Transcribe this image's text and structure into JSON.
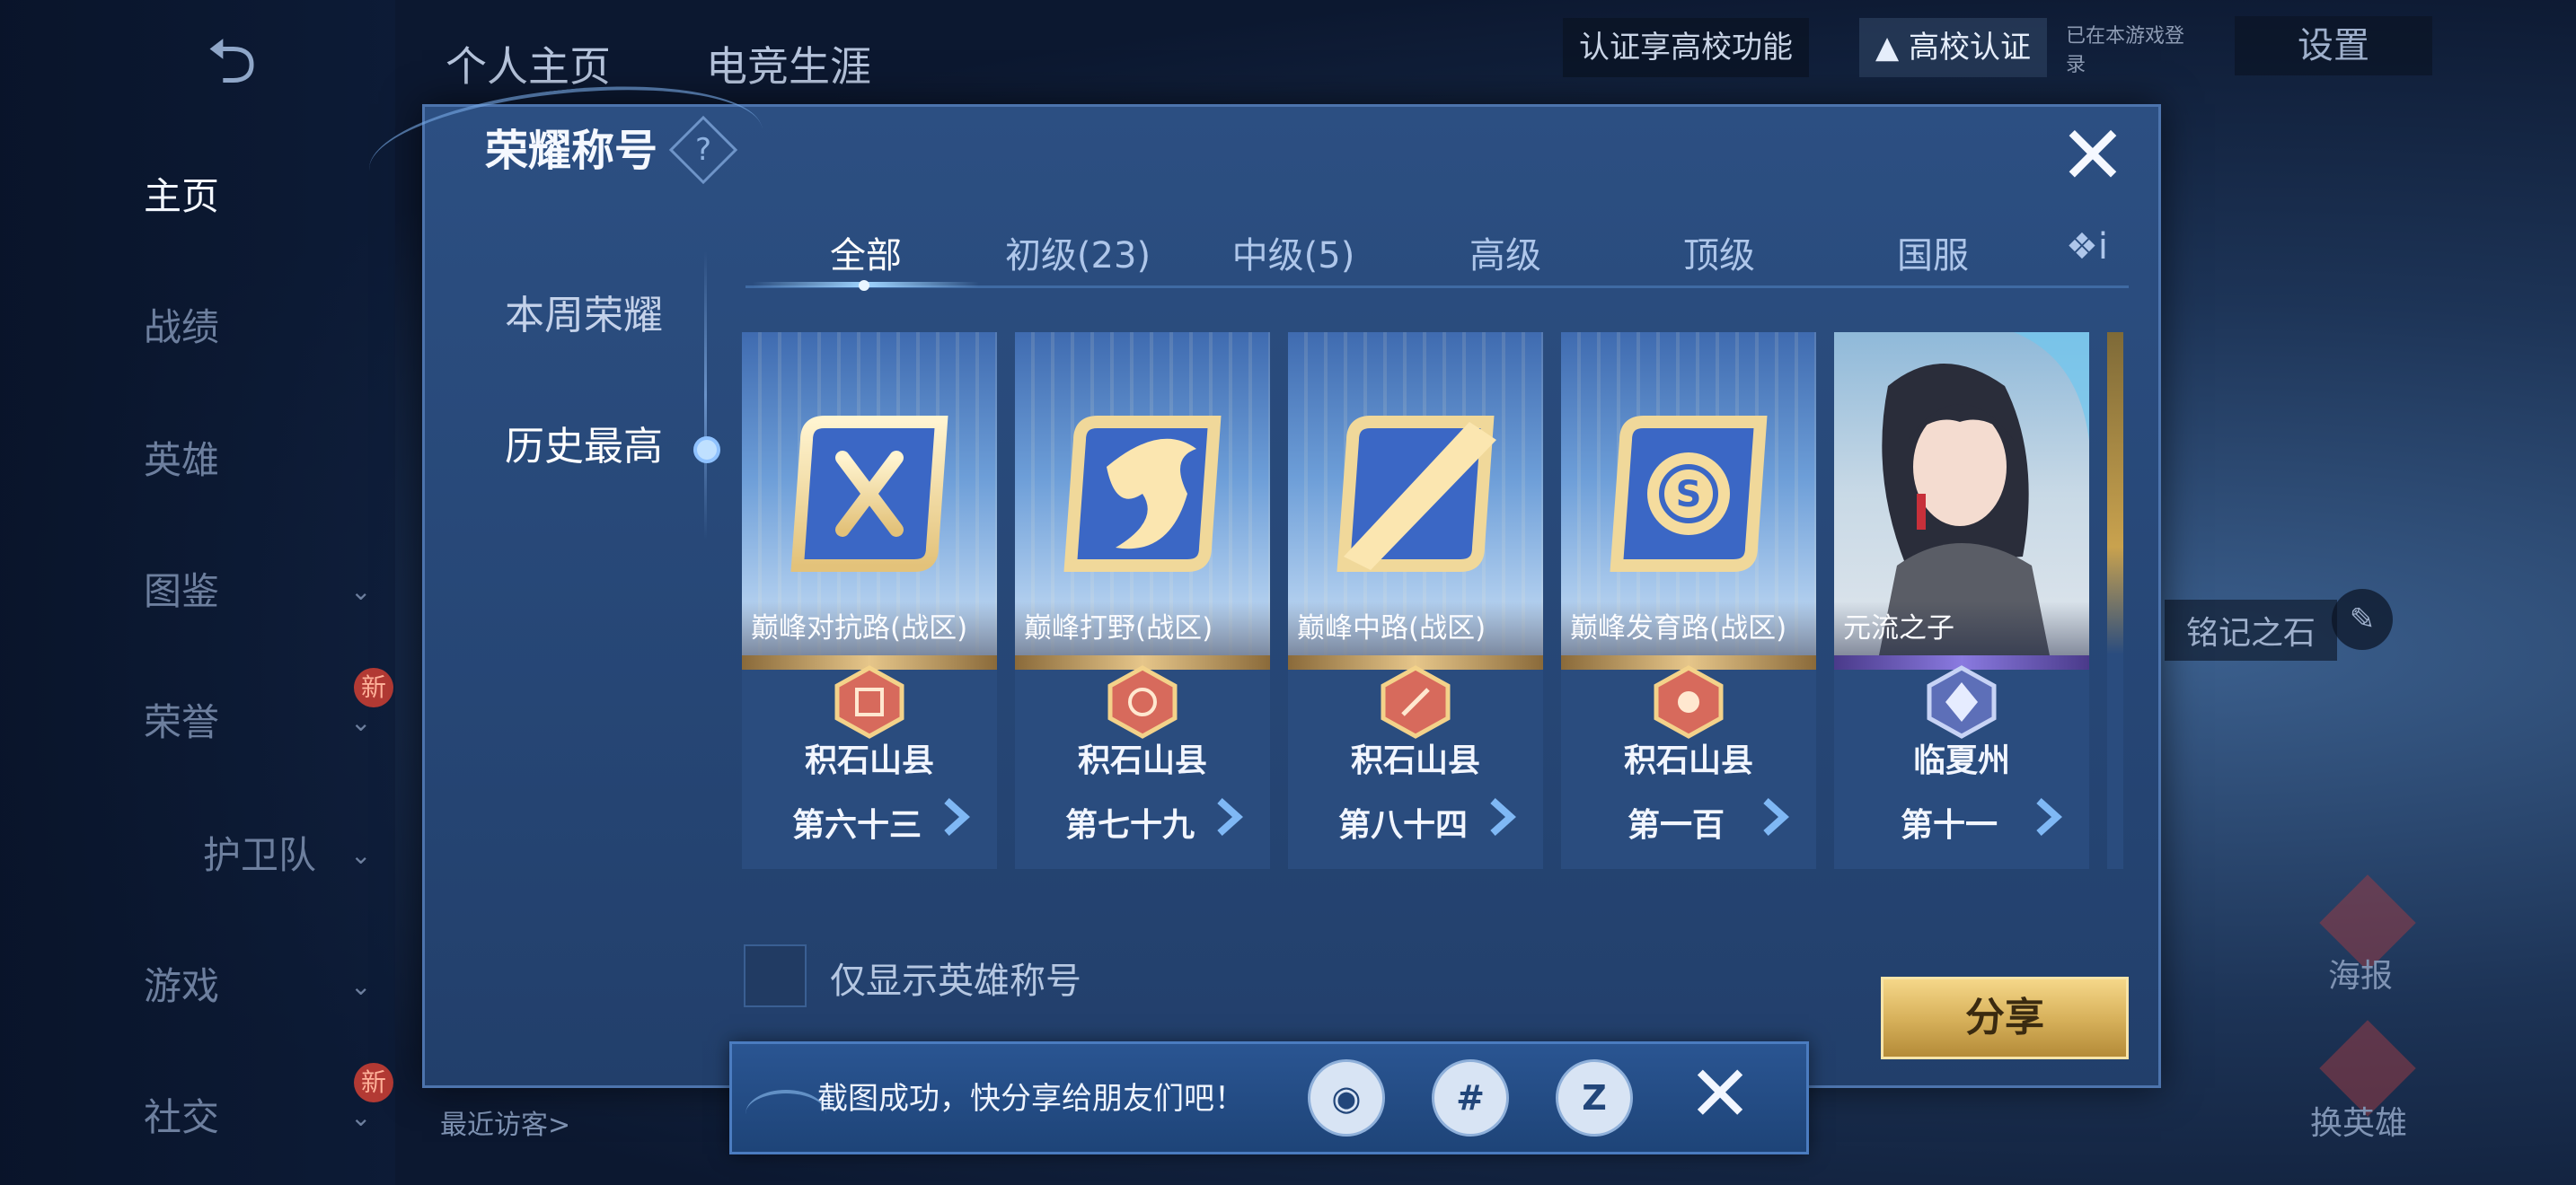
{
  "nav": {
    "back_icon": "back-arrow-icon",
    "items": [
      {
        "label": "主页",
        "active": true,
        "chevron": false,
        "badge": ""
      },
      {
        "label": "战绩",
        "active": false,
        "chevron": false,
        "badge": ""
      },
      {
        "label": "英雄",
        "active": false,
        "chevron": false,
        "badge": ""
      },
      {
        "label": "图鉴",
        "active": false,
        "chevron": true,
        "badge": ""
      },
      {
        "label": "荣誉",
        "active": false,
        "chevron": true,
        "badge": "新"
      },
      {
        "label": "护卫队",
        "active": false,
        "chevron": true,
        "badge": ""
      },
      {
        "label": "游戏",
        "active": false,
        "chevron": true,
        "badge": ""
      },
      {
        "label": "社交",
        "active": false,
        "chevron": true,
        "badge": "新"
      }
    ],
    "recent_visitors": "最近访客>"
  },
  "top": {
    "tabs": [
      "个人主页",
      "电竞生涯"
    ],
    "cert_prompt": "认证享高校功能",
    "cert_button": "高校认证",
    "online_status": "已在本游戏登录",
    "settings": "设置"
  },
  "background": {
    "inscription": "铭记之石",
    "poster": "海报",
    "change_hero": "换英雄"
  },
  "modal": {
    "title": "荣耀称号",
    "side_tabs": [
      {
        "label": "本周荣耀",
        "active": false
      },
      {
        "label": "历史最高",
        "active": true
      }
    ],
    "category_tabs": [
      {
        "label": "全部",
        "active": true
      },
      {
        "label": "初级(23)",
        "active": false
      },
      {
        "label": "中级(5)",
        "active": false
      },
      {
        "label": "高级",
        "active": false
      },
      {
        "label": "顶级",
        "active": false
      },
      {
        "label": "国服",
        "active": false
      },
      {
        "label": "❖i",
        "active": false
      }
    ],
    "cards": [
      {
        "name": "巅峰对抗路(战区)",
        "region": "积石山县",
        "rank": "第六十三",
        "emblem": "sword-emblem-icon"
      },
      {
        "name": "巅峰打野(战区)",
        "region": "积石山县",
        "rank": "第七十九",
        "emblem": "dragon-emblem-icon"
      },
      {
        "name": "巅峰中路(战区)",
        "region": "积石山县",
        "rank": "第八十四",
        "emblem": "slash-emblem-icon"
      },
      {
        "name": "巅峰发育路(战区)",
        "region": "积石山县",
        "rank": "第一百",
        "emblem": "coin-emblem-icon"
      },
      {
        "name": "元流之子",
        "region": "临夏州",
        "rank": "第十一",
        "emblem": "hero-portrait"
      }
    ],
    "checkbox_label": "仅显示英雄称号",
    "share": "分享"
  },
  "toast": {
    "message": "截图成功，快分享给朋友们吧！",
    "icons": [
      "qq-icon",
      "wechat-icon",
      "qzone-icon"
    ],
    "icon_glyphs": [
      "◉",
      "#",
      "Z"
    ]
  },
  "colors": {
    "modal_bg": "#2c4f82",
    "gold": "#d8b25c",
    "card_sky": "#6d9ed8"
  }
}
